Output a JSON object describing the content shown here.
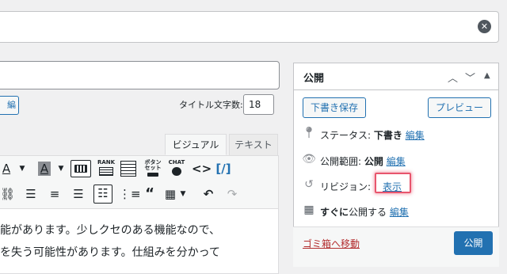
{
  "top_field": {
    "clear_icon": "close-circle-icon"
  },
  "title_area": {
    "edit_label": "編",
    "count_label": "タイトル文字数:",
    "count_value": "18"
  },
  "editor": {
    "tabs": {
      "visual": "ビジュアル",
      "text": "テキスト"
    },
    "toolbar_labels": {
      "rank": "RANK",
      "button_set": "ボタン\nセット",
      "chat": "CHAT"
    },
    "content_lines": [
      "能があります。少しクセのある機能なので、",
      "を失う可能性があります。仕組みを分かって"
    ]
  },
  "publish_box": {
    "title": "公開",
    "save_draft": "下書き保存",
    "preview": "プレビュー",
    "status_label": "ステータス:",
    "status_value": "下書き",
    "visibility_label": "公開範囲:",
    "visibility_value": "公開",
    "revision_label": "リビジョン:",
    "revision_link": "表示",
    "schedule_label": "すぐに",
    "schedule_suffix": "公開する",
    "edit_link": "編集",
    "trash": "ゴミ箱へ移動",
    "publish": "公開",
    "highlight_color": "#e8556d",
    "accent_color": "#2271b1"
  }
}
